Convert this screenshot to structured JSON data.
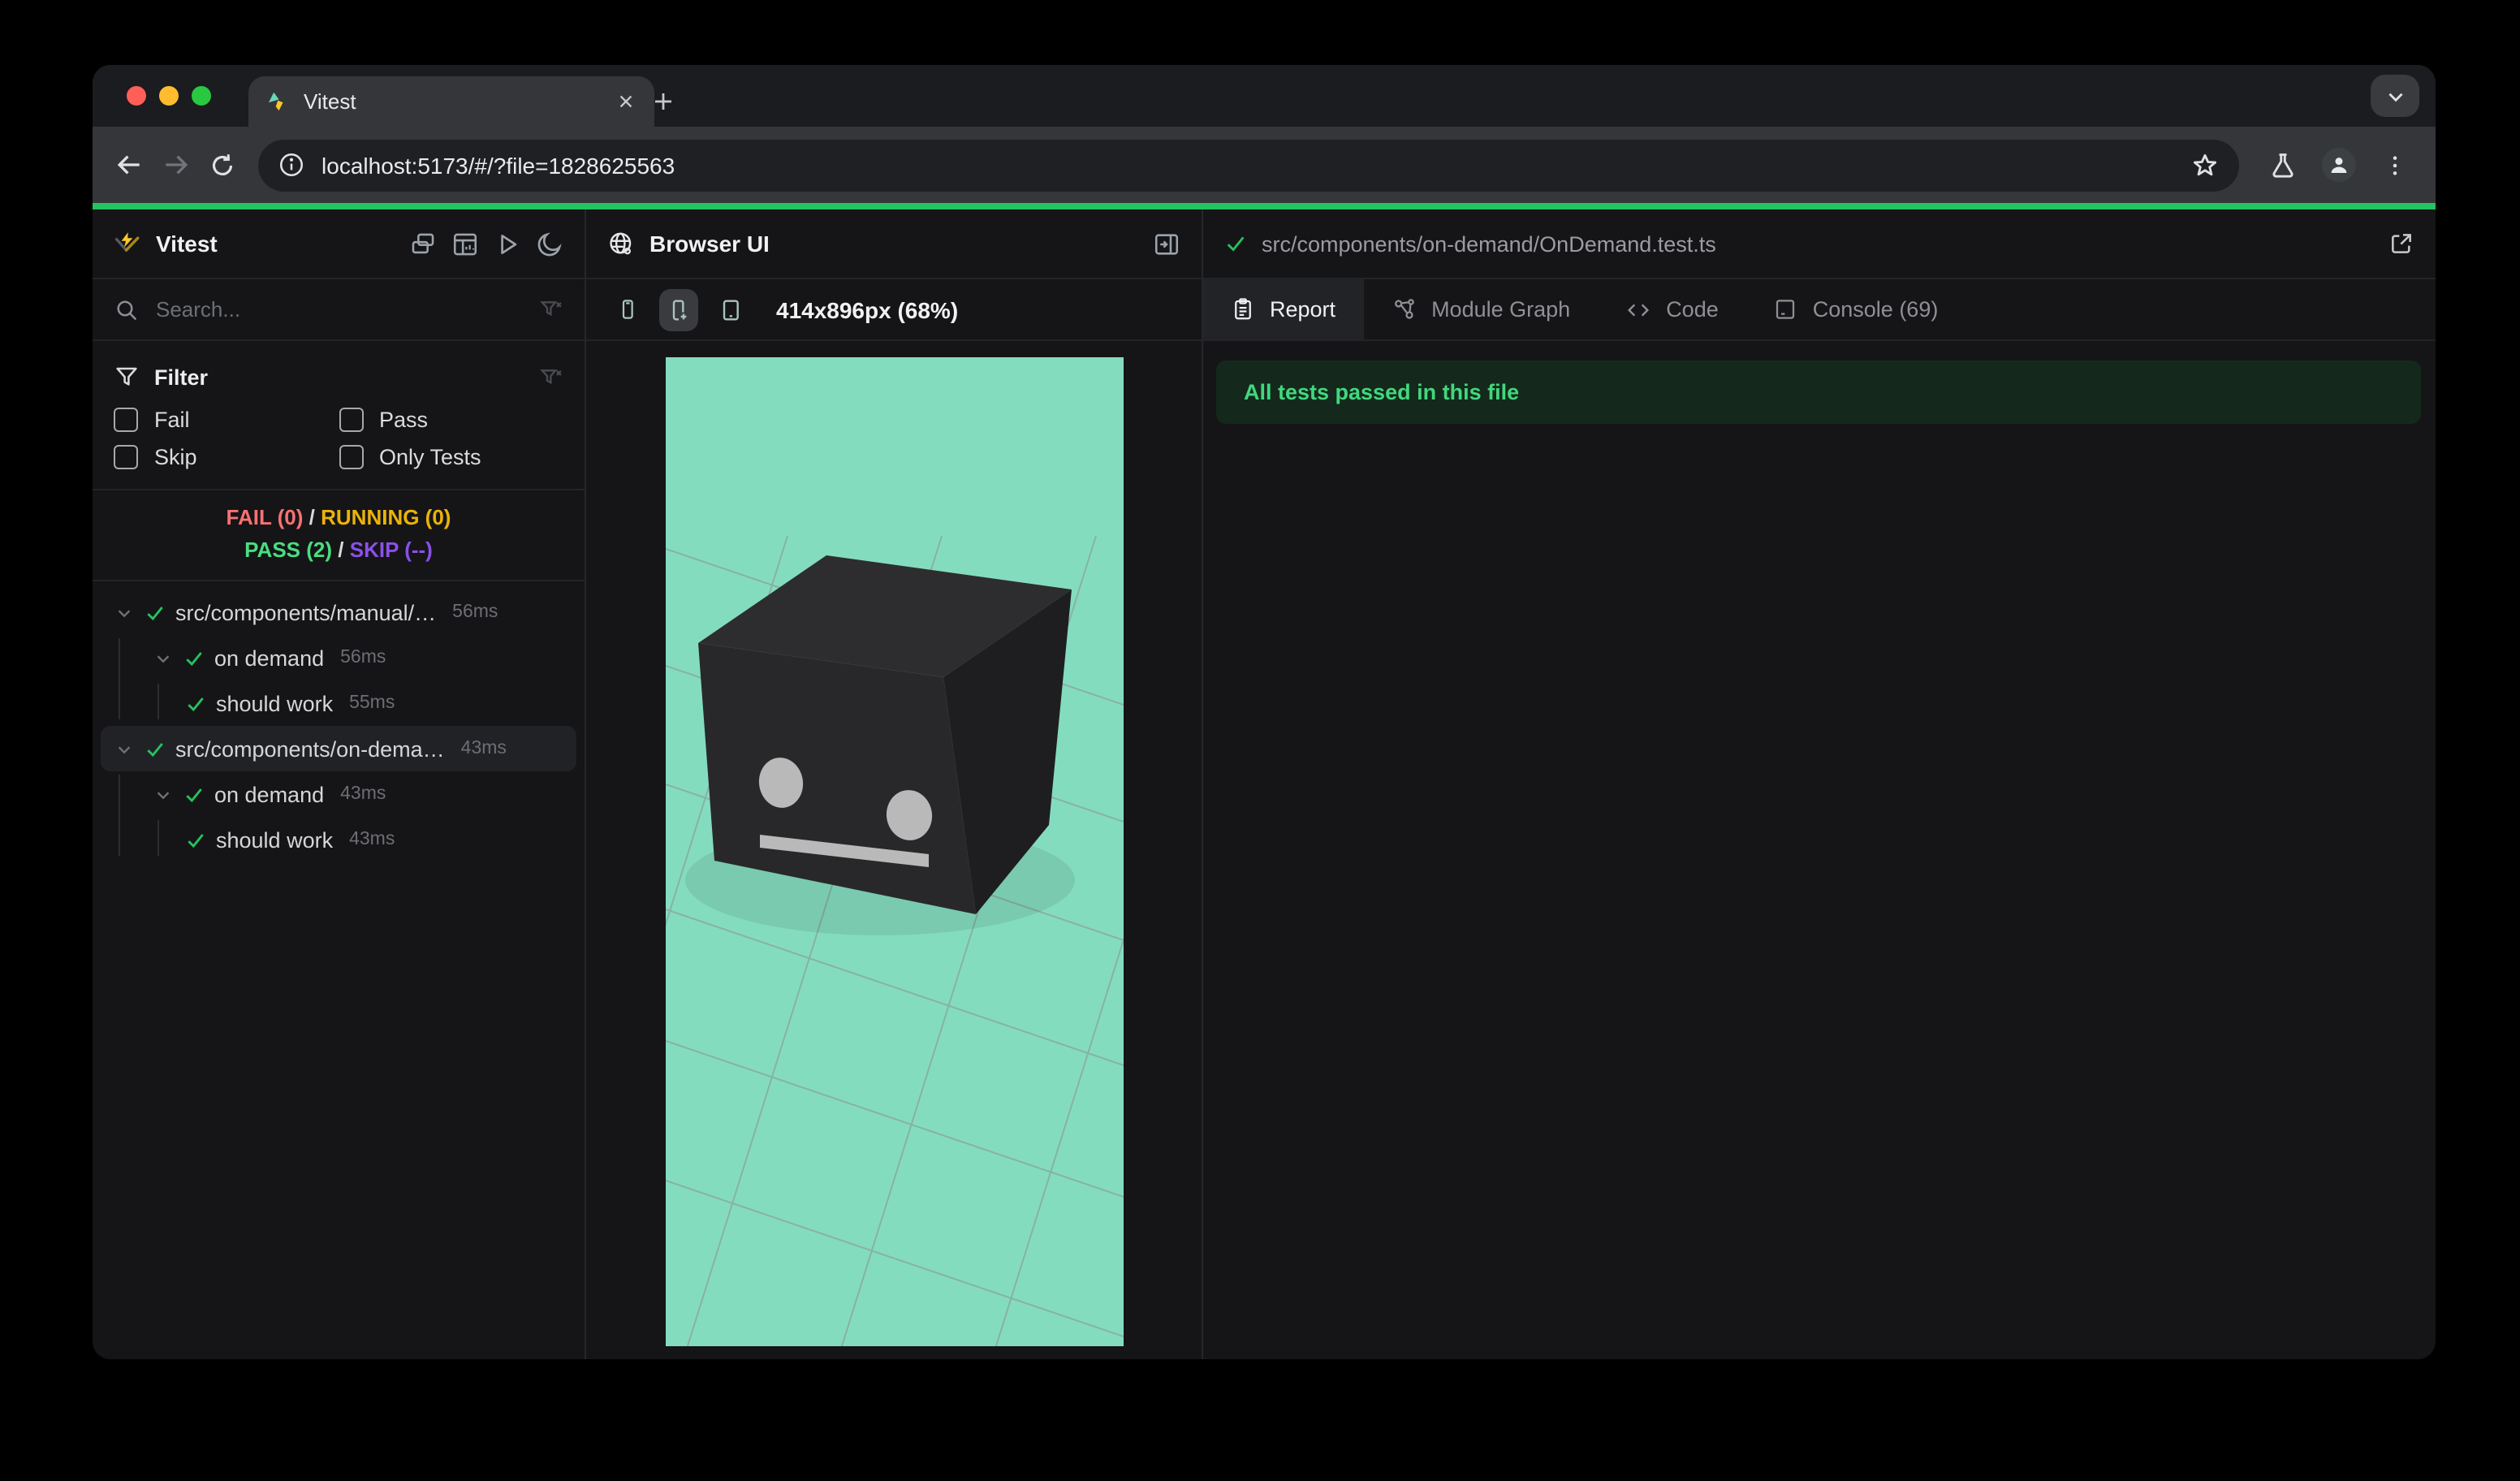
{
  "browser": {
    "tab_title": "Vitest",
    "url": "localhost:5173/#/?file=1828625563"
  },
  "sidebar": {
    "title": "Vitest",
    "search_placeholder": "Search...",
    "filter": {
      "title": "Filter",
      "options": [
        "Fail",
        "Pass",
        "Skip",
        "Only Tests"
      ]
    },
    "status": {
      "fail": "FAIL (0)",
      "sep1": "/",
      "running": "RUNNING (0)",
      "pass": "PASS (2)",
      "sep2": "/",
      "skip": "SKIP (--)"
    },
    "tree": {
      "rows": [
        {
          "label": "src/components/manual/…",
          "time": "56ms"
        },
        {
          "label": "on demand",
          "time": "56ms"
        },
        {
          "label": "should work",
          "time": "55ms"
        },
        {
          "label": "src/components/on-dema…",
          "time": "43ms"
        },
        {
          "label": "on demand",
          "time": "43ms"
        },
        {
          "label": "should work",
          "time": "43ms"
        }
      ]
    }
  },
  "browser_ui": {
    "title": "Browser UI",
    "dimensions": "414x896px (68%)"
  },
  "report": {
    "file_path": "src/components/on-demand/OnDemand.test.ts",
    "tabs": [
      {
        "label": "Report"
      },
      {
        "label": "Module Graph"
      },
      {
        "label": "Code"
      },
      {
        "label": "Console (69)"
      }
    ],
    "banner": "All tests passed in this file"
  },
  "colors": {
    "accent_green": "#22c55e",
    "fail_red": "#f87171",
    "running_yellow": "#eab308",
    "pass_green": "#4ade80",
    "skip_purple": "#8b50e8",
    "banner_bg": "#14291c",
    "banner_text": "#42d77d",
    "traffic_close": "#ff5f57",
    "traffic_min": "#febc2e",
    "traffic_max": "#28c840"
  },
  "scene": {
    "background": "#84dcbe",
    "grid_line": "#8a8a8a",
    "cube_top": "#2d2d2f",
    "cube_front": "#28282a",
    "cube_right": "#1e1e20",
    "face_gray": "#b9b9b9"
  }
}
